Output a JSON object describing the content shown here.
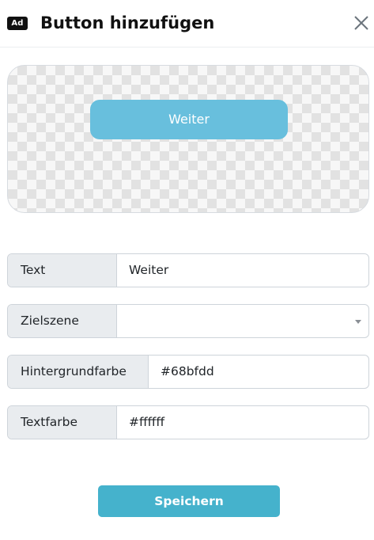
{
  "header": {
    "badge": "Ad",
    "title": "Button hinzufügen",
    "close_icon": "close-icon"
  },
  "preview": {
    "button_label": "Weiter",
    "button_bg": "#68bfdd",
    "button_text_color": "#ffffff"
  },
  "form": {
    "text": {
      "label": "Text",
      "value": "Weiter"
    },
    "target_scene": {
      "label": "Zielszene",
      "value": ""
    },
    "background_color": {
      "label": "Hintergrundfarbe",
      "value": "#68bfdd"
    },
    "text_color": {
      "label": "Textfarbe",
      "value": "#ffffff"
    }
  },
  "footer": {
    "save_label": "Speichern",
    "save_bg": "#45b2cc"
  }
}
